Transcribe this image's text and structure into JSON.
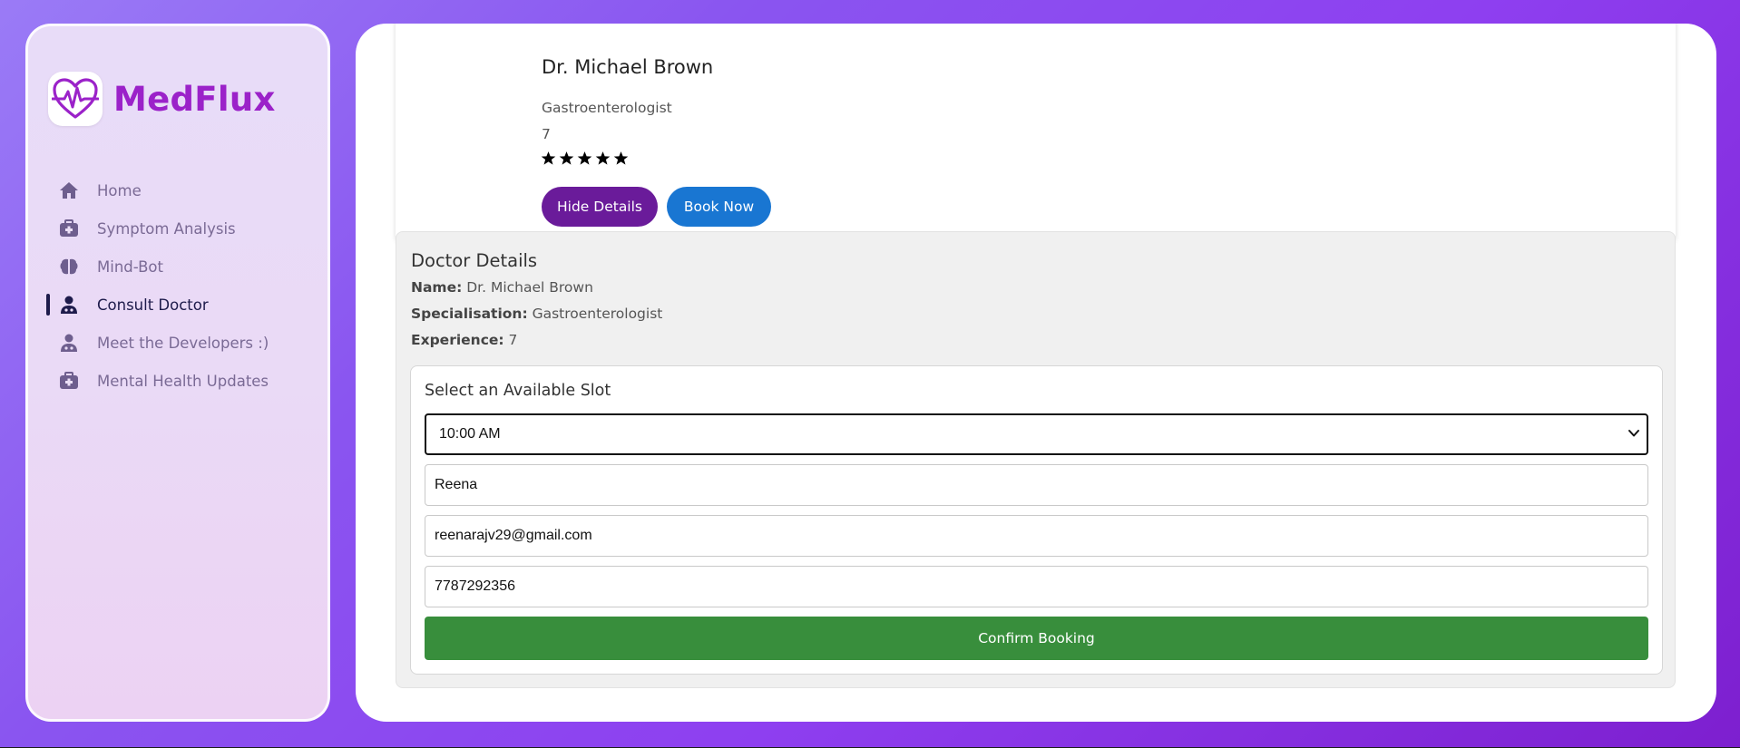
{
  "brand": {
    "name": "MedFlux",
    "accent": "#9b22c9"
  },
  "sidebar": {
    "items": [
      {
        "label": "Home",
        "icon": "home-icon"
      },
      {
        "label": "Symptom Analysis",
        "icon": "medical-kit-icon"
      },
      {
        "label": "Mind-Bot",
        "icon": "brain-icon"
      },
      {
        "label": "Consult Doctor",
        "icon": "doctor-icon",
        "active": true
      },
      {
        "label": "Meet the Developers :)",
        "icon": "doctor-icon"
      },
      {
        "label": "Mental Health Updates",
        "icon": "medical-kit-icon"
      }
    ]
  },
  "doctor_card": {
    "name": "Dr. Michael Brown",
    "specialization": "Gastroenterologist",
    "experience": "7",
    "rating": 5,
    "hide_details_label": "Hide Details",
    "book_now_label": "Book Now"
  },
  "details": {
    "title": "Doctor Details",
    "name_label": "Name:",
    "name_value": "Dr. Michael Brown",
    "spec_label": "Specialisation:",
    "spec_value": "Gastroenterologist",
    "exp_label": "Experience:",
    "exp_value": "7"
  },
  "booking": {
    "title": "Select an Available Slot",
    "selected_slot": "10:00 AM",
    "name_value": "Reena",
    "email_value": "reenarajv29@gmail.com",
    "phone_value": "7787292356",
    "confirm_label": "Confirm Booking"
  }
}
